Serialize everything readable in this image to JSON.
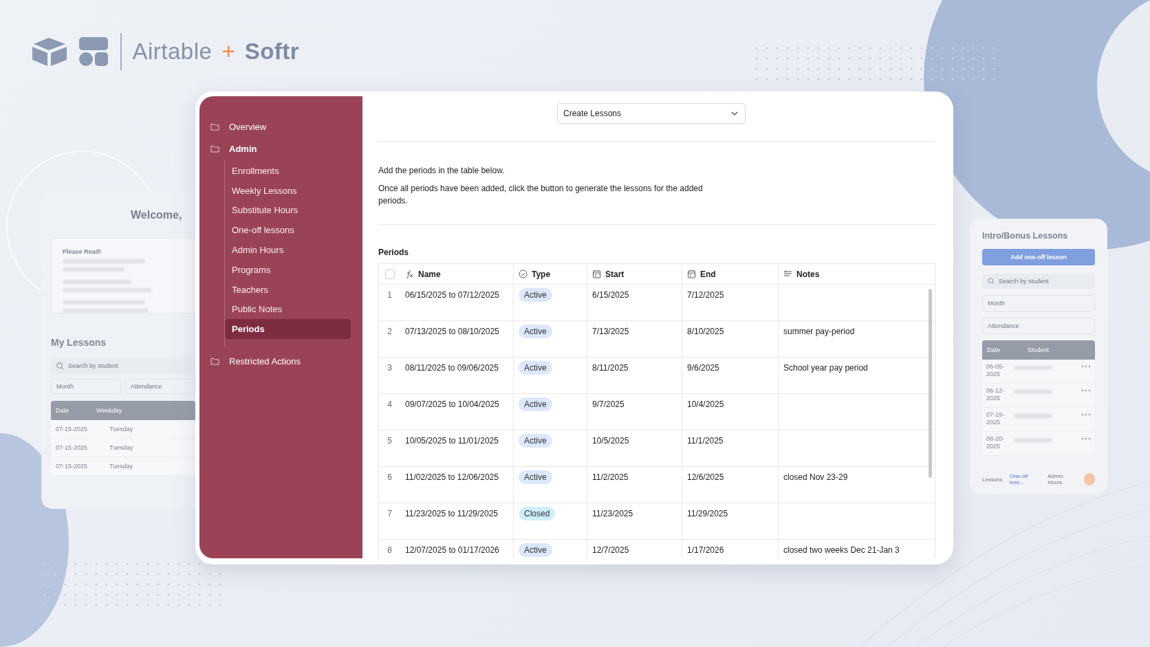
{
  "logo": {
    "brand_1": "Airtable",
    "plus": "+",
    "brand_2": "Softr"
  },
  "left_screen": {
    "heading": "Welcome,",
    "notice_title": "Please Read!",
    "section_title": "My Lessons",
    "search": {
      "placeholder": "Search by student"
    },
    "filters": [
      "Month",
      "Attendance"
    ],
    "columns": [
      "Date",
      "Weekday"
    ],
    "rows": [
      {
        "date": "07-15-2025",
        "weekday": "Tuesday"
      },
      {
        "date": "07-15-2025",
        "weekday": "Tuesday"
      },
      {
        "date": "07-15-2025",
        "weekday": "Tuesday"
      }
    ]
  },
  "right_screen": {
    "title": "Intro/Bonus Lessons",
    "button": "Add one-off lesson",
    "search": {
      "placeholder": "Search by student"
    },
    "filters": [
      "Month",
      "Attendance"
    ],
    "columns": [
      "Date",
      "Student"
    ],
    "rows": [
      {
        "date": "06-05-2025"
      },
      {
        "date": "06-12-2025"
      },
      {
        "date": "07-19-2025"
      },
      {
        "date": "08-20-2025"
      }
    ],
    "nav": [
      {
        "label": "Lessons",
        "selected": false
      },
      {
        "label": "One-off less...",
        "selected": true
      },
      {
        "label": "Admin Hours",
        "selected": false
      }
    ]
  },
  "app": {
    "sidebar": {
      "items": [
        {
          "label": "Overview",
          "selected": false,
          "expanded": false
        },
        {
          "label": "Admin",
          "selected": false,
          "expanded": true,
          "children": [
            {
              "label": "Enrollments",
              "selected": false
            },
            {
              "label": "Weekly Lessons",
              "selected": false
            },
            {
              "label": "Substitute Hours",
              "selected": false
            },
            {
              "label": "One-off lessons",
              "selected": false
            },
            {
              "label": "Admin Hours",
              "selected": false
            },
            {
              "label": "Programs",
              "selected": false
            },
            {
              "label": "Teachers",
              "selected": false
            },
            {
              "label": "Public Notes",
              "selected": false
            },
            {
              "label": "Periods",
              "selected": true
            }
          ]
        },
        {
          "label": "Restricted Actions",
          "selected": false,
          "expanded": false
        }
      ]
    },
    "dropdown": {
      "value": "Create Lessons"
    },
    "instructions": [
      "Add the periods in the table below.",
      "Once all periods have been added, click the button to generate the lessons for the added periods."
    ],
    "table": {
      "title": "Periods",
      "select_all": {
        "checked": false
      },
      "columns": [
        "Name",
        "Type",
        "Start",
        "End",
        "Notes"
      ],
      "rows": [
        {
          "num": "1",
          "name": "06/15/2025 to 07/12/2025",
          "type": {
            "label": "Active",
            "color": "#dce8fb"
          },
          "start": "6/15/2025",
          "end": "7/12/2025"
        },
        {
          "num": "2",
          "name": "07/13/2025 to 08/10/2025",
          "type": {
            "label": "Active",
            "color": "#dce8fb"
          },
          "start": "7/13/2025",
          "end": "8/10/2025",
          "notes": "summer pay-period"
        },
        {
          "num": "3",
          "name": "08/11/2025 to 09/06/2025",
          "type": {
            "label": "Active",
            "color": "#dce8fb"
          },
          "start": "8/11/2025",
          "end": "9/6/2025",
          "notes": "School year pay period"
        },
        {
          "num": "4",
          "name": "09/07/2025 to 10/04/2025",
          "type": {
            "label": "Active",
            "color": "#dce8fb"
          },
          "start": "9/7/2025",
          "end": "10/4/2025"
        },
        {
          "num": "5",
          "name": "10/05/2025 to 11/01/2025",
          "type": {
            "label": "Active",
            "color": "#dce8fb"
          },
          "start": "10/5/2025",
          "end": "11/1/2025"
        },
        {
          "num": "6",
          "name": "11/02/2025 to 12/06/2025",
          "type": {
            "label": "Active",
            "color": "#dce8fb"
          },
          "start": "11/2/2025",
          "end": "12/6/2025",
          "notes": "closed Nov 23-29"
        },
        {
          "num": "7",
          "name": "11/23/2025 to 11/29/2025",
          "type": {
            "label": "Closed",
            "color": "#cfeef9"
          },
          "start": "11/23/2025",
          "end": "11/29/2025"
        },
        {
          "num": "8",
          "name": "12/07/2025 to 01/17/2026",
          "type": {
            "label": "Active",
            "color": "#dce8fb"
          },
          "start": "12/7/2025",
          "end": "1/17/2026",
          "notes": "closed two weeks Dec 21-Jan 3"
        }
      ]
    }
  }
}
